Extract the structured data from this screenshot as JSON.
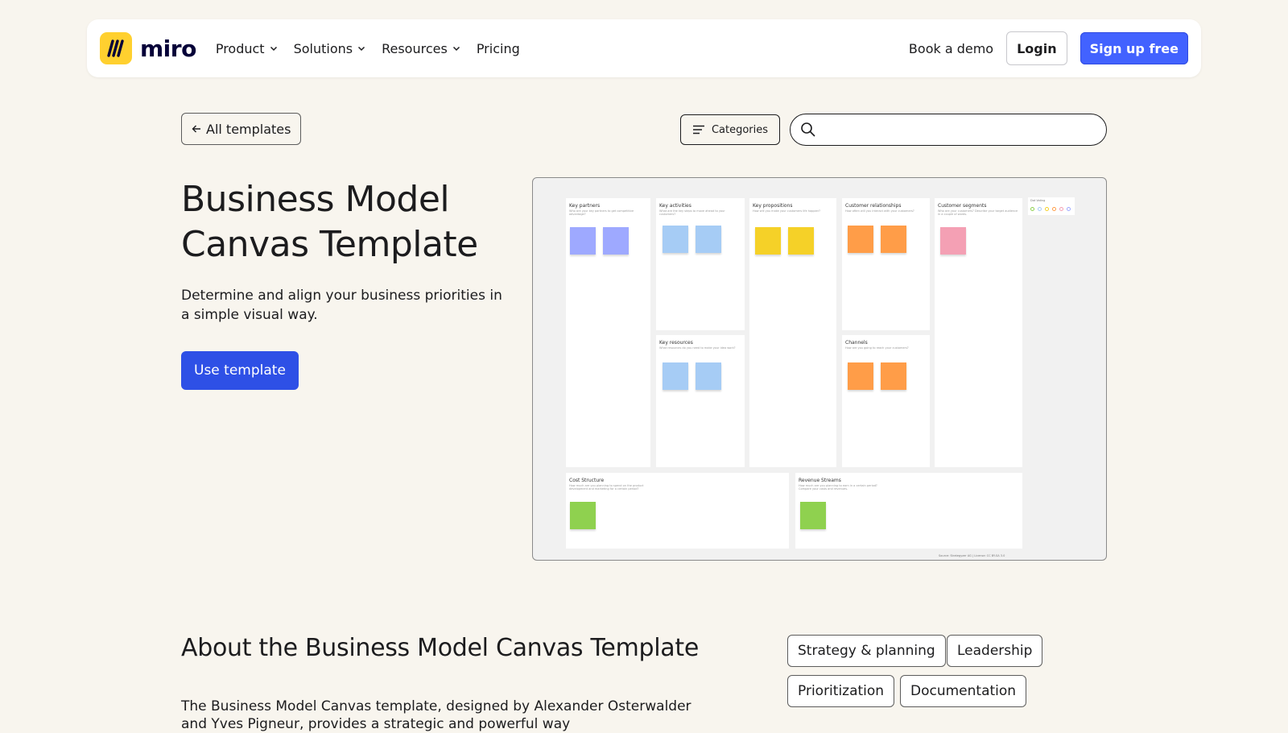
{
  "header": {
    "brand": "miro",
    "nav": [
      {
        "label": "Product",
        "has_dropdown": true
      },
      {
        "label": "Solutions",
        "has_dropdown": true
      },
      {
        "label": "Resources",
        "has_dropdown": true
      },
      {
        "label": "Pricing",
        "has_dropdown": false
      }
    ],
    "book_demo": "Book a demo",
    "login": "Login",
    "signup": "Sign up free"
  },
  "toolbar": {
    "back_label": "All templates",
    "categories_label": "Categories",
    "search_placeholder": "",
    "search_value": ""
  },
  "hero": {
    "title": "Business Model Canvas Template",
    "description": "Determine and align your business priorities in a simple visual way.",
    "cta": "Use template"
  },
  "preview": {
    "sections": [
      {
        "title": "Key partners",
        "subtitle": "Who are your key partners to get competitive advantage?"
      },
      {
        "title": "Key activities",
        "subtitle": "What are the key steps to move ahead to your customers?"
      },
      {
        "title": "Key propositions",
        "subtitle": "How will you make your customers life happier?"
      },
      {
        "title": "Customer relationships",
        "subtitle": "How often will you interact with your customers?"
      },
      {
        "title": "Customer segments",
        "subtitle": "Who are your customers? Describe your target audience in a couple of words."
      },
      {
        "title": "Key resources",
        "subtitle": "What resources do you need to make your idea work?"
      },
      {
        "title": "Channels",
        "subtitle": "How are you going to reach your customers?"
      },
      {
        "title": "Cost Structure",
        "subtitle": "How much are you planning to spend on the product development and marketing for a certain period?"
      },
      {
        "title": "Revenue Streams",
        "subtitle": "How much are you planning to earn in a certain period? Compare your costs and revenues."
      }
    ],
    "legend_title": "Dot Voting",
    "source_note": "Source: Strategyzer AG | License: CC BY-SA 3.0",
    "colors": {
      "purple": "#9ea9ff",
      "blue": "#a6ccf5",
      "yellow": "#f5d128",
      "orange": "#ff9d48",
      "pink": "#f4a0b4",
      "green": "#8fd14f"
    }
  },
  "about": {
    "title": "About the Business Model Canvas Template",
    "text": "The Business Model Canvas template, designed by Alexander Osterwalder and Yves Pigneur, provides a strategic and powerful way"
  },
  "tags": [
    "Strategy & planning",
    "Leadership",
    "Prioritization",
    "Documentation"
  ],
  "colors": {
    "accent": "#4262ff",
    "cta": "#2e50e6",
    "background": "#f8f5ee",
    "logo": "#ffd02f"
  }
}
